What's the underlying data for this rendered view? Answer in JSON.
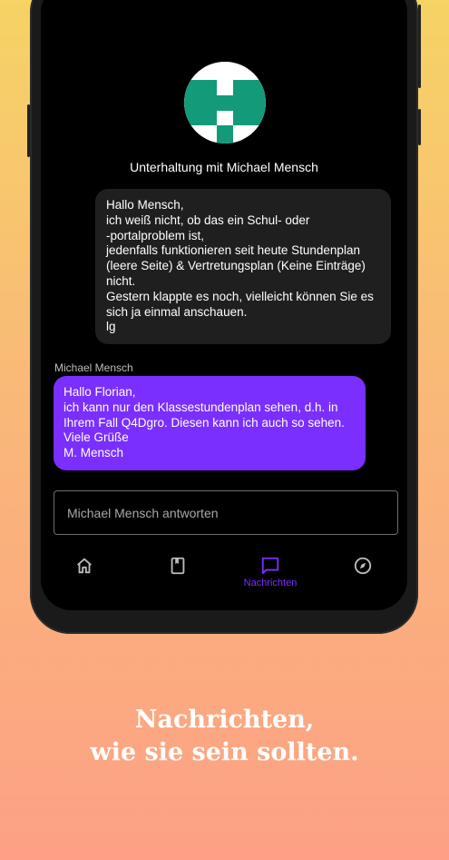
{
  "conversation": {
    "title": "Unterhaltung mit Michael Mensch"
  },
  "messages": [
    {
      "lines": [
        "Hallo Mensch,",
        "ich weiß nicht, ob das ein Schul- oder",
        "-portalproblem ist,",
        "jedenfalls funktionieren seit heute Stundenplan",
        "(leere Seite) & Vertretungsplan (Keine Einträge)",
        "nicht.",
        "Gestern klappte es noch, vielleicht können Sie es",
        "sich ja einmal anschauen.",
        "lg"
      ]
    },
    {
      "sender": "Michael Mensch",
      "lines": [
        "Hallo Florian,",
        "ich kann nur den Klassestundenplan sehen, d.h. in",
        "Ihrem Fall Q4Dgro. Diesen kann ich auch so sehen.",
        "Viele Grüße",
        "M. Mensch"
      ]
    }
  ],
  "reply": {
    "placeholder": "Michael Mensch antworten"
  },
  "nav": {
    "items": [
      {
        "icon": "home-icon",
        "label": ""
      },
      {
        "icon": "book-icon",
        "label": ""
      },
      {
        "icon": "chat-icon",
        "label": "Nachrichten",
        "active": true
      },
      {
        "icon": "compass-icon",
        "label": ""
      }
    ]
  },
  "promo": {
    "line1": "Nachrichten,",
    "line2": "wie sie sein sollten."
  },
  "colors": {
    "accent": "#7a2fff",
    "avatar_green": "#139b79"
  }
}
